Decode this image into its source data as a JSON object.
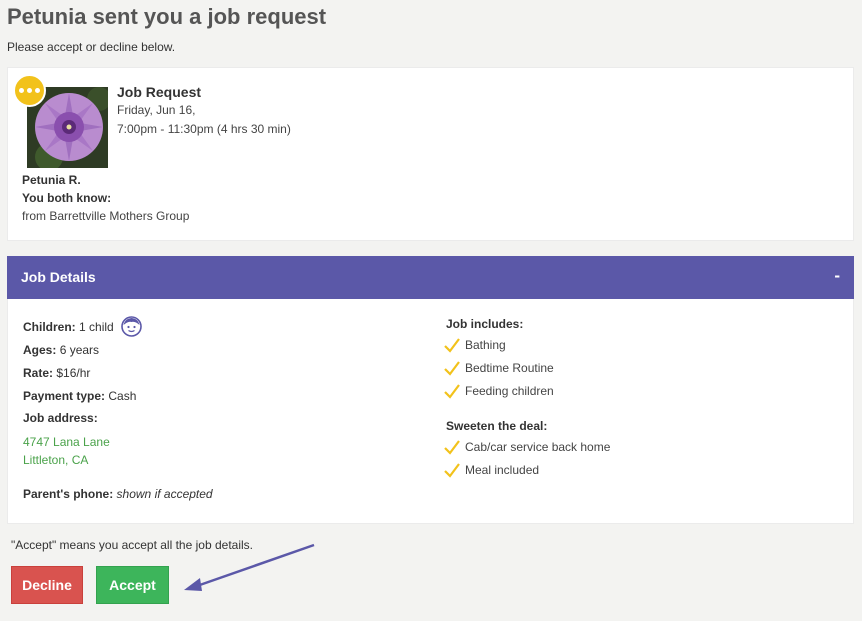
{
  "page": {
    "title": "Petunia sent you a job request",
    "subtitle": "Please accept or decline below."
  },
  "request": {
    "title": "Job Request",
    "date": "Friday, Jun 16,",
    "time": "7:00pm - 11:30pm (4 hrs 30 min)",
    "parent_name": "Petunia R.",
    "both_know_label": "You both know:",
    "group": "from Barrettville Mothers Group"
  },
  "details": {
    "title": "Job Details",
    "collapse_label": "-",
    "children_label": "Children:",
    "children_value": "1 child",
    "ages_label": "Ages:",
    "ages_value": "6 years",
    "rate_label": "Rate:",
    "rate_value": "$16/hr",
    "payment_label": "Payment type:",
    "payment_value": "Cash",
    "address_label": "Job address:",
    "address_line1": "4747 Lana Lane",
    "address_line2": "Littleton, CA",
    "phone_label": "Parent's phone:",
    "phone_value": "shown if accepted",
    "includes_label": "Job includes:",
    "includes": [
      "Bathing",
      "Bedtime Routine",
      "Feeding children"
    ],
    "sweeten_label": "Sweeten the deal:",
    "sweeten": [
      "Cab/car service back home",
      "Meal included"
    ]
  },
  "footer": {
    "note": "\"Accept\" means you accept all the job details.",
    "decline_label": "Decline",
    "accept_label": "Accept"
  },
  "colors": {
    "header_bg": "#5b58a8",
    "accept": "#3db55b",
    "decline": "#d9534f",
    "check": "#f2c21b",
    "address": "#4aa24a"
  },
  "icons": [
    "more-icon",
    "child-face-icon",
    "check-icon",
    "arrow-icon"
  ]
}
